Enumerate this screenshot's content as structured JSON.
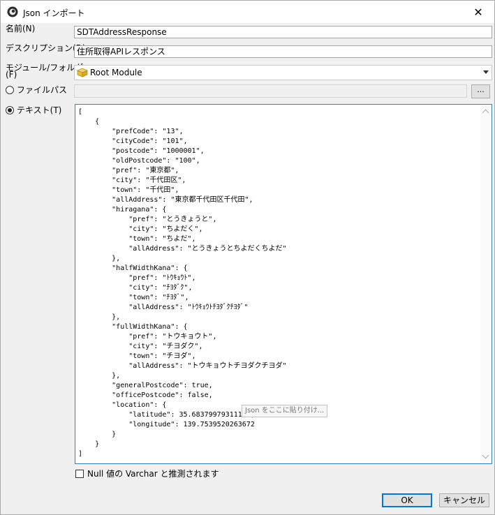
{
  "window": {
    "title": "Json インポート",
    "close_glyph": "✕"
  },
  "form": {
    "name_label": "名前(N)",
    "name_value": "SDTAddressResponse",
    "description_label": "デスクリプション(D)",
    "description_value": "住所取得APIレスポンス",
    "module_label_line1": "モジュール/フォルダ",
    "module_label_line2": "(F)",
    "module_value": "Root Module",
    "filepath_label": "ファイルパス",
    "filepath_value": "",
    "browse_label": "...",
    "text_label": "テキスト(T)",
    "selected_source": "text"
  },
  "editor": {
    "content": "[\n    {\n        \"prefCode\": \"13\",\n        \"cityCode\": \"101\",\n        \"postcode\": \"1000001\",\n        \"oldPostcode\": \"100\",\n        \"pref\": \"東京都\",\n        \"city\": \"千代田区\",\n        \"town\": \"千代田\",\n        \"allAddress\": \"東京都千代田区千代田\",\n        \"hiragana\": {\n            \"pref\": \"とうきょうと\",\n            \"city\": \"ちよだく\",\n            \"town\": \"ちよだ\",\n            \"allAddress\": \"とうきょうとちよだくちよだ\"\n        },\n        \"halfWidthKana\": {\n            \"pref\": \"ﾄｳｷｮｳﾄ\",\n            \"city\": \"ﾁﾖﾀﾞｸ\",\n            \"town\": \"ﾁﾖﾀﾞ\",\n            \"allAddress\": \"ﾄｳｷｮｳﾄﾁﾖﾀﾞｸﾁﾖﾀﾞ\"\n        },\n        \"fullWidthKana\": {\n            \"pref\": \"トウキョウト\",\n            \"city\": \"チヨダク\",\n            \"town\": \"チヨダ\",\n            \"allAddress\": \"トウキョウトチヨダクチヨダ\"\n        },\n        \"generalPostcode\": true,\n        \"officePostcode\": false,\n        \"location\": {\n            \"latitude\": 35.68379979311144,\n            \"longitude\": 139.7539520263672\n        }\n    }\n]",
    "tooltip": "Json をここに貼り付け..."
  },
  "options": {
    "null_varchar_label": "Null 値の Varchar と推測されます",
    "null_varchar_checked": false
  },
  "buttons": {
    "ok": "OK",
    "cancel": "キャンセル"
  },
  "colors": {
    "focus_border": "#3c7fb1",
    "default_button_border": "#0078d7",
    "dialog_bg": "#f0f0f0"
  }
}
